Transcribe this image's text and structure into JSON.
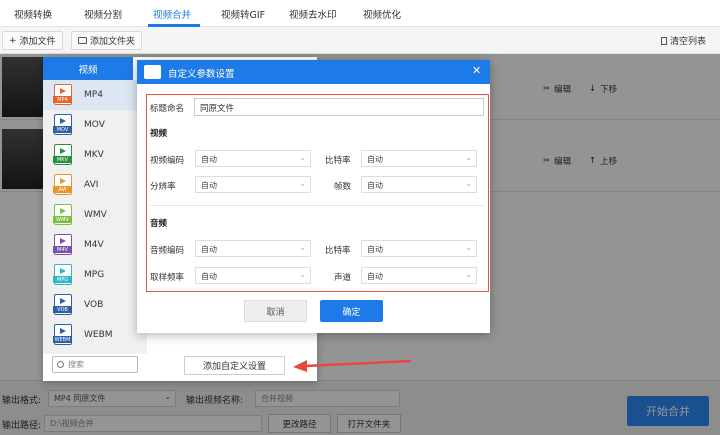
{
  "tabs": [
    {
      "label": "视频转换"
    },
    {
      "label": "视频分割"
    },
    {
      "label": "视频合并"
    },
    {
      "label": "视频转GIF"
    },
    {
      "label": "视频去水印"
    },
    {
      "label": "视频优化"
    }
  ],
  "toolbar": {
    "add_file": "添加文件",
    "add_folder": "添加文件夹",
    "clear_list": "清空列表"
  },
  "rows": [
    {
      "edit": "编辑",
      "move": "下移"
    },
    {
      "edit": "编辑",
      "move": "上移"
    }
  ],
  "format_panel": {
    "header": "视频",
    "formats": [
      {
        "label": "MP4",
        "tag": "MP4",
        "color": "#e8642c"
      },
      {
        "label": "MOV",
        "tag": "MOV",
        "color": "#2f5fa7"
      },
      {
        "label": "MKV",
        "tag": "MKV",
        "color": "#2a8f3f"
      },
      {
        "label": "AVI",
        "tag": "AVI",
        "color": "#e8952c"
      },
      {
        "label": "WMV",
        "tag": "WMV",
        "color": "#7bc043"
      },
      {
        "label": "M4V",
        "tag": "M4V",
        "color": "#7c4fb0"
      },
      {
        "label": "MPG",
        "tag": "MPG",
        "color": "#2cb7c9"
      },
      {
        "label": "VOB",
        "tag": "VOB",
        "color": "#2f5fa7"
      },
      {
        "label": "WEBM",
        "tag": "WEBM",
        "color": "#2f5fa7"
      }
    ],
    "search_placeholder": "搜索",
    "add_custom": "添加自定义设置"
  },
  "dialog": {
    "title": "自定义参数设置",
    "name_label": "标题命名",
    "name_value": "同原文件",
    "video_section": "视频",
    "audio_section": "音频",
    "video_codec_label": "视频编码",
    "video_codec_value": "自动",
    "video_bitrate_label": "比特率",
    "video_bitrate_value": "自动",
    "resolution_label": "分辨率",
    "resolution_value": "自动",
    "framerate_label": "帧数",
    "framerate_value": "自动",
    "audio_codec_label": "音频编码",
    "audio_codec_value": "自动",
    "audio_bitrate_label": "比特率",
    "audio_bitrate_value": "自动",
    "samplerate_label": "取样频率",
    "samplerate_value": "自动",
    "channel_label": "声道",
    "channel_value": "自动",
    "cancel": "取消",
    "ok": "确定"
  },
  "bottom": {
    "format_label": "输出格式:",
    "format_value": "MP4  同原文件",
    "name_label": "输出视频名称:",
    "name_value": "合并视频",
    "path_label": "输出路径:",
    "path_value": "D:\\视频合并",
    "change_path": "更改路径",
    "open_folder": "打开文件夹",
    "start": "开始合并"
  }
}
